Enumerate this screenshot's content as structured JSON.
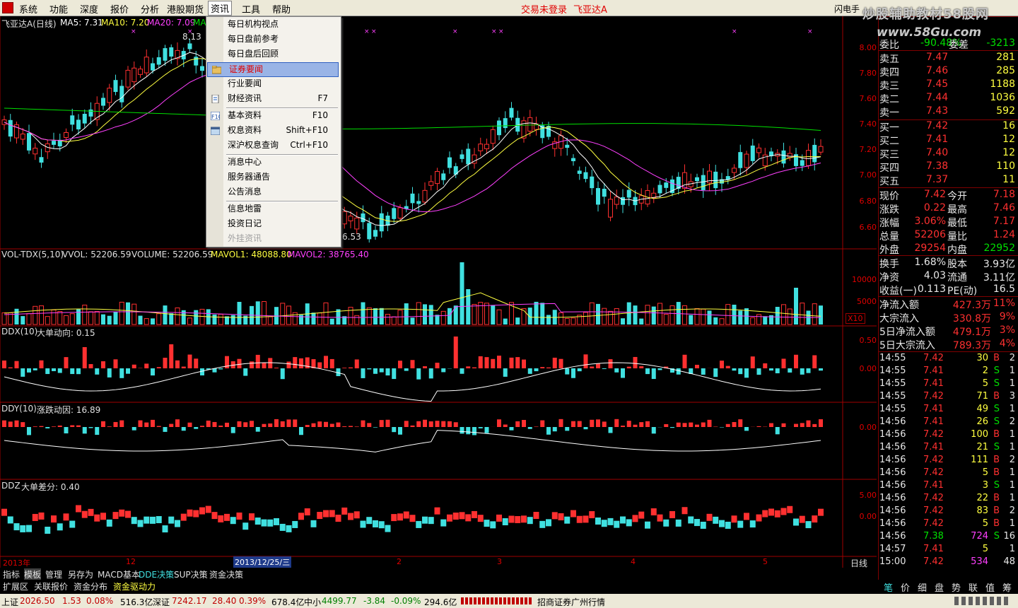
{
  "menubar": {
    "items": [
      "系统",
      "功能",
      "深度",
      "报价",
      "分析",
      "港股期货",
      "资讯",
      "工具",
      "帮助"
    ],
    "status_center": "交易未登录",
    "stock_name_center": "飞亚达A",
    "right_label": "闪电手"
  },
  "watermark": {
    "line1": "炒股辅助教材58股网",
    "line2": "www.58Gu.com"
  },
  "main_chart": {
    "title": "飞亚达A(日线)",
    "ma5": "MA5: 7.31",
    "ma10": "MA10: 7.20",
    "ma20": "MA20: 7.09",
    "ma_more": "MA",
    "high_mark": "8.13",
    "low_mark": "6.53",
    "yticks": [
      "8.00",
      "7.80",
      "7.60",
      "7.40",
      "7.20",
      "7.00",
      "6.80",
      "6.60"
    ],
    "colors": {
      "up": "#ff3030",
      "down": "#40e0e0",
      "ma5": "#ffffff",
      "ma10": "#ffff40",
      "ma20": "#ff40ff",
      "ma60": "#00e000"
    }
  },
  "vol_panel": {
    "title": "VOL-TDX(5,10)",
    "vvol": "VVOL: 52206.59",
    "volume": "VOLUME: 52206.59",
    "mavol1": "MAVOL1: 48088.80",
    "mavol2": "MAVOL2: 38765.40",
    "yticks": [
      "10000",
      "5000"
    ],
    "unit": "X10"
  },
  "ddx_panel": {
    "title": "DDX(10)",
    "label": "大单动向: 0.15",
    "yticks": [
      "0.50",
      "0.00"
    ]
  },
  "ddy_panel": {
    "title": "DDY(10)",
    "label": "涨跌动因: 16.89",
    "yticks": [
      "0.00"
    ]
  },
  "ddz_panel": {
    "title": "DDZ",
    "label": "大单差分: 0.40",
    "yticks": [
      "5.00",
      "0.00"
    ]
  },
  "date_axis": {
    "labels": [
      "2013年",
      "12",
      "2013/12/25/三",
      "2",
      "3",
      "4",
      "5"
    ],
    "period": "日线"
  },
  "dropdown": {
    "items": [
      {
        "label": "每日机构视点",
        "key": ""
      },
      {
        "label": "每日盘前参考",
        "key": ""
      },
      {
        "label": "每日盘后回顾",
        "key": ""
      },
      {
        "label": "证券要闻",
        "key": "",
        "highlighted": true
      },
      {
        "label": "行业要闻",
        "key": ""
      },
      {
        "label": "财经资讯",
        "key": "F7"
      },
      {
        "label": "基本资料",
        "key": "F10"
      },
      {
        "label": "权息资料",
        "key": "Shift+F10"
      },
      {
        "label": "深沪权息查询",
        "key": "Ctrl+F10"
      },
      {
        "label": "消息中心",
        "key": ""
      },
      {
        "label": "服务器通告",
        "key": ""
      },
      {
        "label": "公告消息",
        "key": ""
      },
      {
        "label": "信息地雷",
        "key": ""
      },
      {
        "label": "投资日记",
        "key": ""
      },
      {
        "label": "外挂资讯",
        "key": "",
        "disabled": true
      }
    ]
  },
  "quote": {
    "weibi": {
      "label": "委比",
      "value": "-90.48%",
      "label2": "委差",
      "value2": "-3213"
    },
    "asks": [
      {
        "label": "卖五",
        "price": "7.47",
        "vol": "281"
      },
      {
        "label": "卖四",
        "price": "7.46",
        "vol": "285"
      },
      {
        "label": "卖三",
        "price": "7.45",
        "vol": "1188"
      },
      {
        "label": "卖二",
        "price": "7.44",
        "vol": "1036"
      },
      {
        "label": "卖一",
        "price": "7.43",
        "vol": "592"
      }
    ],
    "bids": [
      {
        "label": "买一",
        "price": "7.42",
        "vol": "16"
      },
      {
        "label": "买二",
        "price": "7.41",
        "vol": "12"
      },
      {
        "label": "买三",
        "price": "7.40",
        "vol": "12"
      },
      {
        "label": "买四",
        "price": "7.38",
        "vol": "110"
      },
      {
        "label": "买五",
        "price": "7.37",
        "vol": "11"
      }
    ],
    "stats": [
      {
        "l1": "现价",
        "v1": "7.42",
        "l2": "今开",
        "v2": "7.18"
      },
      {
        "l1": "涨跌",
        "v1": "0.22",
        "l2": "最高",
        "v2": "7.46"
      },
      {
        "l1": "涨幅",
        "v1": "3.06%",
        "l2": "最低",
        "v2": "7.17"
      },
      {
        "l1": "总量",
        "v1": "52206",
        "l2": "量比",
        "v2": "1.24"
      },
      {
        "l1": "外盘",
        "v1": "29254",
        "l2": "内盘",
        "v2": "22952"
      }
    ],
    "fund": [
      {
        "l1": "换手",
        "v1": "1.68%",
        "l2": "股本",
        "v2": "3.93亿"
      },
      {
        "l1": "净资",
        "v1": "4.03",
        "l2": "流通",
        "v2": "3.11亿"
      },
      {
        "l1": "收益(一)",
        "v1": "0.113",
        "l2": "PE(动)",
        "v2": "16.5"
      }
    ],
    "flows": [
      {
        "label": "净流入额",
        "value": "427.3万",
        "pct": "11%"
      },
      {
        "label": "大宗流入",
        "value": "330.8万",
        "pct": "9%"
      },
      {
        "label": "5日净流入额",
        "value": "479.1万",
        "pct": "3%"
      },
      {
        "label": "5日大宗流入",
        "value": "789.3万",
        "pct": "4%"
      }
    ],
    "ticks": [
      {
        "t": "14:55",
        "p": "7.42",
        "v": "30",
        "s": "B",
        "n": "2"
      },
      {
        "t": "14:55",
        "p": "7.41",
        "v": "2",
        "s": "S",
        "n": "1"
      },
      {
        "t": "14:55",
        "p": "7.41",
        "v": "5",
        "s": "S",
        "n": "1"
      },
      {
        "t": "14:55",
        "p": "7.42",
        "v": "71",
        "s": "B",
        "n": "3"
      },
      {
        "t": "14:55",
        "p": "7.41",
        "v": "49",
        "s": "S",
        "n": "1"
      },
      {
        "t": "14:56",
        "p": "7.41",
        "v": "26",
        "s": "S",
        "n": "2"
      },
      {
        "t": "14:56",
        "p": "7.42",
        "v": "100",
        "s": "B",
        "n": "1"
      },
      {
        "t": "14:56",
        "p": "7.41",
        "v": "21",
        "s": "S",
        "n": "1"
      },
      {
        "t": "14:56",
        "p": "7.42",
        "v": "111",
        "s": "B",
        "n": "2"
      },
      {
        "t": "14:56",
        "p": "7.42",
        "v": "5",
        "s": "B",
        "n": "1"
      },
      {
        "t": "14:56",
        "p": "7.41",
        "v": "3",
        "s": "S",
        "n": "1"
      },
      {
        "t": "14:56",
        "p": "7.42",
        "v": "22",
        "s": "B",
        "n": "1"
      },
      {
        "t": "14:56",
        "p": "7.42",
        "v": "83",
        "s": "B",
        "n": "2"
      },
      {
        "t": "14:56",
        "p": "7.42",
        "v": "5",
        "s": "B",
        "n": "1"
      },
      {
        "t": "14:56",
        "p": "7.38",
        "v": "724",
        "s": "S",
        "n": "16"
      },
      {
        "t": "14:57",
        "p": "7.41",
        "v": "5",
        "s": "",
        "n": "1"
      },
      {
        "t": "15:00",
        "p": "7.42",
        "v": "534",
        "s": "",
        "n": "48"
      }
    ],
    "tabs": [
      "笔",
      "价",
      "细",
      "盘",
      "势",
      "联",
      "值",
      "筹"
    ]
  },
  "bottom_tabs1": [
    "指标",
    "模板",
    "管理",
    "另存为",
    "MACD基本",
    "DDE决策",
    "SUP决策",
    "资金决策"
  ],
  "bottom_tabs2": [
    "扩展区",
    "关联报价",
    "资金分布",
    "资金驱动力"
  ],
  "statusbar": {
    "sh_label": "上证",
    "sh_val": "2026.50",
    "sh_chg": "1.53",
    "sh_pct": "0.08%",
    "sh_amt": "516.3亿",
    "sz_label": "深证",
    "sz_val": "7242.17",
    "sz_chg": "28.40",
    "sz_pct": "0.39%",
    "sz_amt": "678.4亿",
    "zx_label": "中小",
    "zx_val": "4499.77",
    "zx_chg": "-3.84",
    "zx_pct": "-0.09%",
    "zx_amt": "294.6亿",
    "broker": "招商证券广州行情"
  }
}
